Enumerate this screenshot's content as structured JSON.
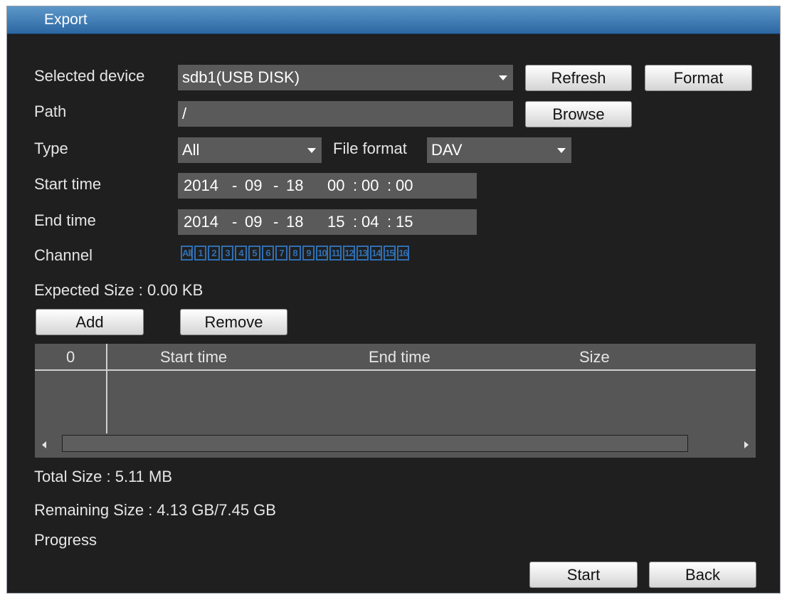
{
  "window": {
    "title": "Export"
  },
  "form": {
    "selected_device_label": "Selected device",
    "selected_device_value": "sdb1(USB DISK)",
    "refresh_label": "Refresh",
    "format_label": "Format",
    "path_label": "Path",
    "path_value": "/",
    "browse_label": "Browse",
    "type_label": "Type",
    "type_value": "All",
    "file_format_label": "File format",
    "file_format_value": "DAV",
    "start_time_label": "Start time",
    "start_time": {
      "year": "2014",
      "month": "09",
      "day": "18",
      "hour": "00",
      "minute": "00",
      "second": "00"
    },
    "end_time_label": "End time",
    "end_time": {
      "year": "2014",
      "month": "09",
      "day": "18",
      "hour": "15",
      "minute": "04",
      "second": "15"
    },
    "date_sep": "-",
    "time_sep": ":",
    "channel_label": "Channel",
    "channels": [
      "All",
      "1",
      "2",
      "3",
      "4",
      "5",
      "6",
      "7",
      "8",
      "9",
      "10",
      "11",
      "12",
      "13",
      "14",
      "15",
      "16"
    ],
    "expected_size": "Expected Size : 0.00 KB",
    "add_label": "Add",
    "remove_label": "Remove"
  },
  "table": {
    "columns": [
      "0",
      "Start time",
      "End time",
      "Size"
    ],
    "rows": []
  },
  "footer": {
    "total_size": "Total Size : 5.11 MB",
    "remaining_size": "Remaining Size : 4.13 GB/7.45 GB",
    "progress_label": "Progress",
    "start_label": "Start",
    "back_label": "Back"
  },
  "colors": {
    "titlebar": "#3a78b6",
    "background": "#1f1f1f",
    "field": "#5a5a5a",
    "channel_border": "#2f6fb2"
  },
  "icons": [
    "dropdown-arrow-icon",
    "scroll-left-icon",
    "scroll-right-icon"
  ]
}
